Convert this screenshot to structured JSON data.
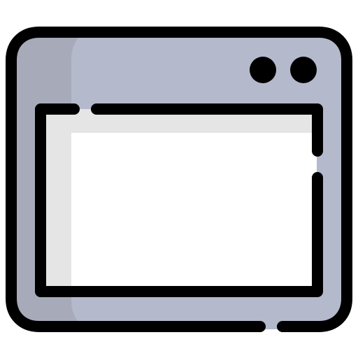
{
  "icon": {
    "name": "browser-window-icon",
    "colors": {
      "outline": "#000000",
      "frame_fill": "#b4b9cc",
      "frame_shade": "#a6aab9",
      "screen_fill": "#ffffff",
      "screen_bar": "#e5e5e5",
      "dots": "#000000"
    }
  }
}
